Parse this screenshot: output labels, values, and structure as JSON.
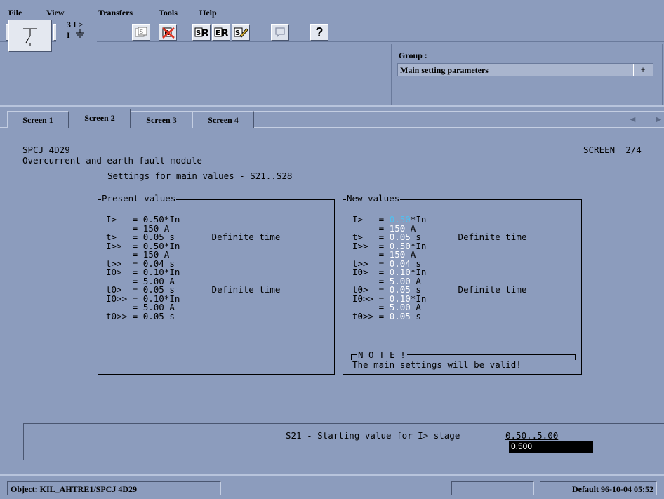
{
  "menu": [
    "File",
    "View",
    "Transfers",
    "Tools",
    "Help"
  ],
  "toolbar": {
    "buttons": [
      "read-from-relay-icon",
      "write-to-relay-icon",
      "read-all-icon",
      "write-all-icon",
      "screen-setting-icon",
      "delete-setting-icon",
      "report-icon",
      "report-alt-icon",
      "edit-report-icon",
      "comment-icon",
      "help-icon"
    ],
    "help_label": "?"
  },
  "header": {
    "symbol_oc_top": "3 I >",
    "symbol_oc_bottom": "I",
    "group_label": "Group :",
    "group_value": "Main setting parameters",
    "dropdown_glyph": "±"
  },
  "tabs": [
    {
      "label": "Screen 1"
    },
    {
      "label": "Screen 2",
      "active": true
    },
    {
      "label": "Screen 3"
    },
    {
      "label": "Screen 4"
    }
  ],
  "screen": {
    "device": "SPCJ 4D29",
    "module": "Overcurrent and earth-fault module",
    "screen_no": "SCREEN  2/4",
    "subtitle": "Settings for main values - S21..S28",
    "present_title": "Present values",
    "new_title": "New values",
    "present_rows": [
      {
        "name": "I>   ",
        "value": "0.50",
        "unit": "*In",
        "note": ""
      },
      {
        "name": "     ",
        "value": "150",
        "unit": " A",
        "note": ""
      },
      {
        "name": "t>   ",
        "value": "0.05",
        "unit": " s",
        "note": "Definite time"
      },
      {
        "name": "I>>  ",
        "value": "0.50",
        "unit": "*In",
        "note": ""
      },
      {
        "name": "     ",
        "value": "150",
        "unit": " A",
        "note": ""
      },
      {
        "name": "t>>  ",
        "value": "0.04",
        "unit": " s",
        "note": ""
      },
      {
        "name": "I0>  ",
        "value": "0.10",
        "unit": "*In",
        "note": ""
      },
      {
        "name": "     ",
        "value": "5.00",
        "unit": " A",
        "note": ""
      },
      {
        "name": "t0>  ",
        "value": "0.05",
        "unit": " s",
        "note": "Definite time"
      },
      {
        "name": "I0>> ",
        "value": "0.10",
        "unit": "*In",
        "note": ""
      },
      {
        "name": "     ",
        "value": "5.00",
        "unit": " A",
        "note": ""
      },
      {
        "name": "t0>> ",
        "value": "0.05",
        "unit": " s",
        "note": ""
      }
    ],
    "note_title": "N O T E !",
    "note_text": "The main settings will be valid!",
    "prompt": "S21 - Starting value for I> stage",
    "range": "0.50..5.00",
    "input_value": "0.500"
  },
  "status": {
    "object": "Object: KIL_AHTRE1/SPCJ 4D29",
    "empty": "",
    "default_info": "Default  96-10-04 05:52"
  },
  "colors": {
    "background": "#8c9cbd",
    "new_value": "#ffffff",
    "highlight_value": "#4fc0f0"
  }
}
